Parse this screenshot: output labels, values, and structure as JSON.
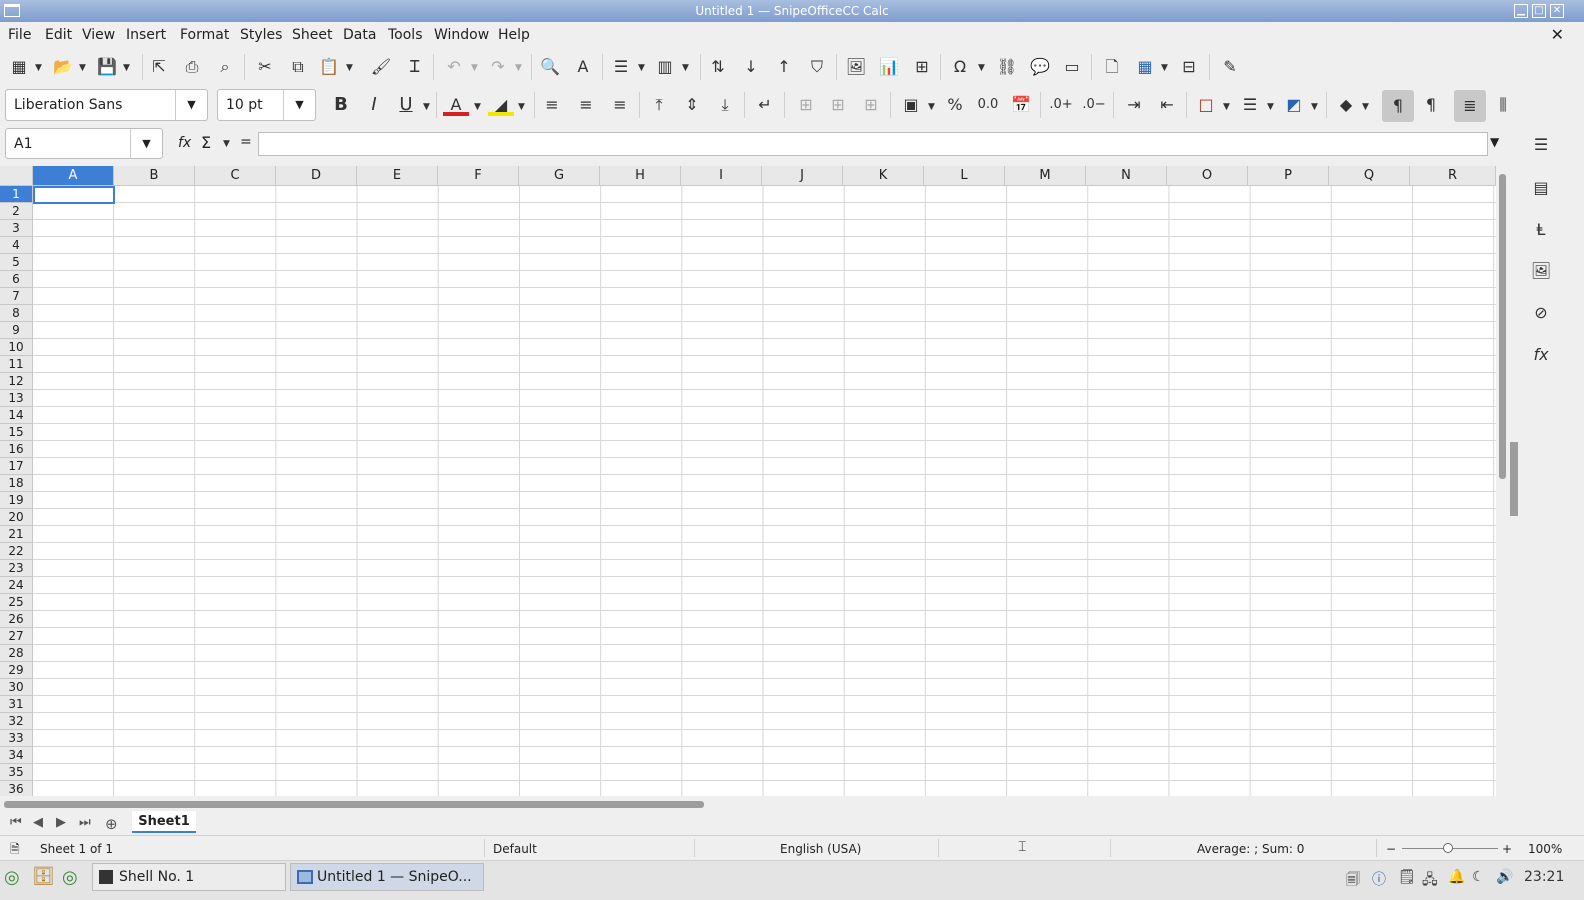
{
  "window": {
    "title": "Untitled 1 — SnipeOfficeCC Calc"
  },
  "menu": [
    "File",
    "Edit",
    "View",
    "Insert",
    "Format",
    "Styles",
    "Sheet",
    "Data",
    "Tools",
    "Window",
    "Help"
  ],
  "format_bar": {
    "font_name": "Liberation Sans",
    "font_size": "10 pt"
  },
  "formula_bar": {
    "name_box": "A1",
    "fx": "fx",
    "sum": "Σ",
    "equals": "=",
    "content": ""
  },
  "columns": [
    "A",
    "B",
    "C",
    "D",
    "E",
    "F",
    "G",
    "H",
    "I",
    "J",
    "K",
    "L",
    "M",
    "N",
    "O",
    "P",
    "Q",
    "R"
  ],
  "rows": [
    "1",
    "2",
    "3",
    "4",
    "5",
    "6",
    "7",
    "8",
    "9",
    "10",
    "11",
    "12",
    "13",
    "14",
    "15",
    "16",
    "17",
    "18",
    "19",
    "20",
    "21",
    "22",
    "23",
    "24",
    "25",
    "26",
    "27",
    "28",
    "29",
    "30",
    "31",
    "32",
    "33",
    "34",
    "35",
    "36"
  ],
  "active_cell": "A1",
  "sheets": [
    "Sheet1"
  ],
  "status": {
    "sheet": "Sheet 1 of 1",
    "page_style": "Default",
    "language": "English (USA)",
    "summary": "Average: ; Sum: 0",
    "zoom": "100%"
  },
  "taskbar": {
    "tasks": [
      "Shell No. 1",
      "Untitled 1 — SnipeO..."
    ],
    "clock": "23:21"
  },
  "colors": {
    "accent": "#3d7fd6",
    "titlebar": "#8aa6d4"
  }
}
